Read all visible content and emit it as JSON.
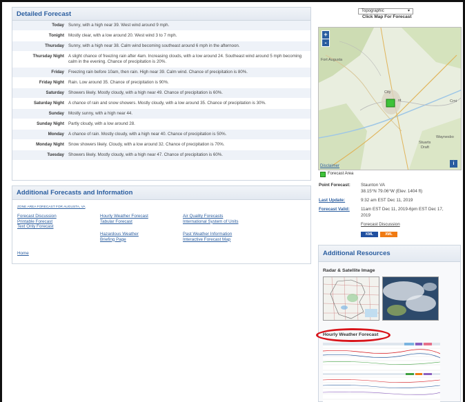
{
  "detailed": {
    "title": "Detailed Forecast",
    "rows": [
      {
        "period": "Today",
        "text": "Sunny, with a high near 39. West wind around 9 mph."
      },
      {
        "period": "Tonight",
        "text": "Mostly clear, with a low around 20. West wind 3 to 7 mph."
      },
      {
        "period": "Thursday",
        "text": "Sunny, with a high near 38. Calm wind becoming southeast around 6 mph in the afternoon."
      },
      {
        "period": "Thursday Night",
        "text": "A slight chance of freezing rain after 4am. Increasing clouds, with a low around 24. Southeast wind around 5 mph becoming calm in the evening. Chance of precipitation is 20%."
      },
      {
        "period": "Friday",
        "text": "Freezing rain before 10am, then rain. High near 39. Calm wind. Chance of precipitation is 80%."
      },
      {
        "period": "Friday Night",
        "text": "Rain. Low around 35. Chance of precipitation is 90%."
      },
      {
        "period": "Saturday",
        "text": "Showers likely. Mostly cloudy, with a high near 49. Chance of precipitation is 60%."
      },
      {
        "period": "Saturday Night",
        "text": "A chance of rain and snow showers. Mostly cloudy, with a low around 35. Chance of precipitation is 30%."
      },
      {
        "period": "Sunday",
        "text": "Mostly sunny, with a high near 44."
      },
      {
        "period": "Sunday Night",
        "text": "Partly cloudy, with a low around 28."
      },
      {
        "period": "Monday",
        "text": "A chance of rain. Mostly cloudy, with a high near 40. Chance of precipitation is 50%."
      },
      {
        "period": "Monday Night",
        "text": "Snow showers likely. Cloudy, with a low around 32. Chance of precipitation is 70%."
      },
      {
        "period": "Tuesday",
        "text": "Showers likely. Mostly cloudy, with a high near 47. Chance of precipitation is 60%."
      }
    ]
  },
  "additional": {
    "title": "Additional Forecasts and Information",
    "zone_link": "ZONE AREA FORECAST FOR AUGUSTA, VA",
    "col1": [
      "Forecast Discussion",
      "Printable Forecast",
      "Text Only Forecast"
    ],
    "col2a": [
      "Hourly Weather Forecast",
      "Tabular Forecast"
    ],
    "col2b": [
      "Hazardous Weather",
      "Briefing Page"
    ],
    "col3a": [
      "Air Quality Forecasts",
      "International System of Units"
    ],
    "col3b": [
      "Past Weather Information",
      "Interactive Forecast Map"
    ],
    "home": "Home"
  },
  "map": {
    "select_value": "Topographic",
    "caption": "Click Map For Forecast",
    "zoom_in": "+",
    "zoom_out": "-",
    "info": "i",
    "disclaimer": "Disclaimer",
    "legend": "Forecast Area",
    "labels": {
      "augusta": "Fort Augusta",
      "city": "City",
      "stuarts": "Stuarts",
      "draft": "Draft",
      "waynesboro": "Waynesbo",
      "cnt": "Crni",
      "nt": "nt"
    },
    "colors": {
      "forecast_area": "#3fc23a",
      "road": "#e0b45a",
      "river": "#9fc7e6"
    }
  },
  "point": {
    "point_label": "Point Forecast:",
    "point_value1": "Staunton VA",
    "point_value2": "38.15°N 79.06°W (Elev. 1404 ft)",
    "update_label": "Last Update:",
    "update_value": "9:32 am EST Dec 11, 2019",
    "valid_label": "Forecast Valid:",
    "valid_value1": "11am EST Dec 11, 2019-6pm EST Dec 17,",
    "valid_value2": "2019",
    "discussion": "Forecast Discussion",
    "kml": "KML",
    "xml": "XML"
  },
  "resources": {
    "title": "Additional Resources",
    "radar_label": "Radar & Satellite Image",
    "hourly_label": "Hourly Weather Forecast",
    "colors": {
      "highlight": "#d8141a",
      "kml": "#1f4fa0",
      "xml": "#f07a12"
    }
  }
}
